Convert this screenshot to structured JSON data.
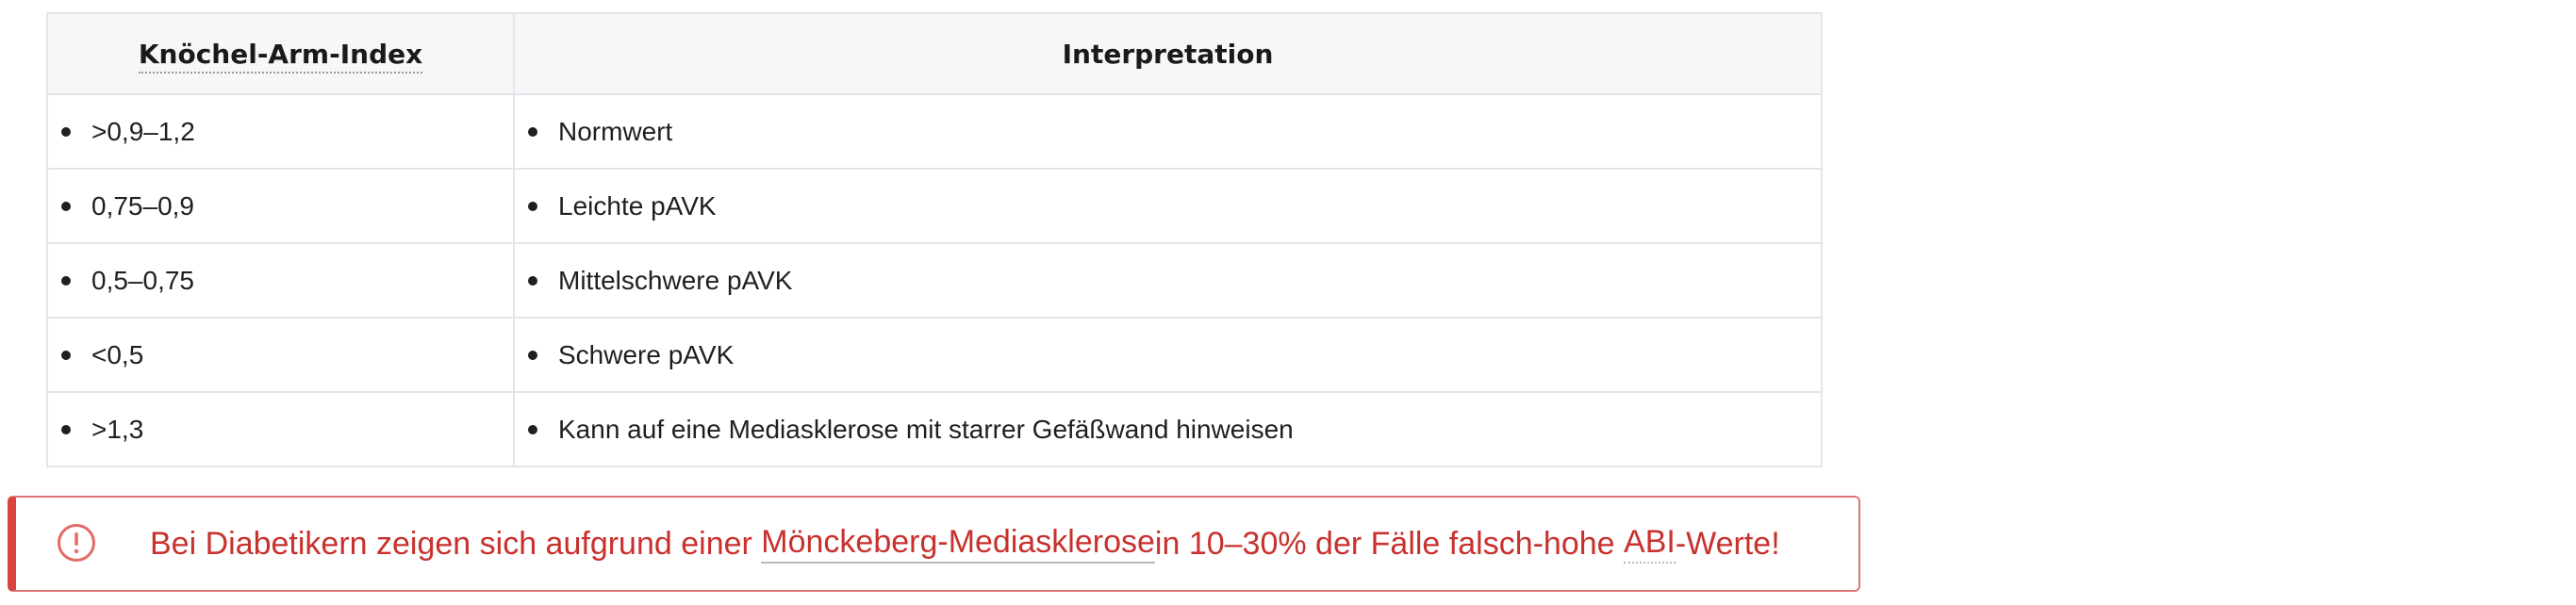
{
  "table": {
    "headers": [
      "Knöchel-Arm-Index",
      "Interpretation"
    ],
    "rows": [
      {
        "index": ">0,9–1,2",
        "interpretation": "Normwert"
      },
      {
        "index": "0,75–0,9",
        "interpretation": "Leichte pAVK"
      },
      {
        "index": "0,5–0,75",
        "interpretation": "Mittelschwere pAVK"
      },
      {
        "index": "<0,5",
        "interpretation": "Schwere pAVK"
      },
      {
        "index": ">1,3",
        "interpretation": "Kann auf eine Mediasklerose mit starrer Gefäßwand hinweisen"
      }
    ]
  },
  "alert": {
    "icon": "exclamation-circle-icon",
    "text_before": "Bei Diabetikern zeigen sich aufgrund einer ",
    "link": "Mönckeberg-Mediasklerose",
    "text_middle": " in 10–30% der Fälle falsch-hohe ",
    "abbr": "ABI",
    "text_after": "-Werte!",
    "color": "#c8312d"
  }
}
